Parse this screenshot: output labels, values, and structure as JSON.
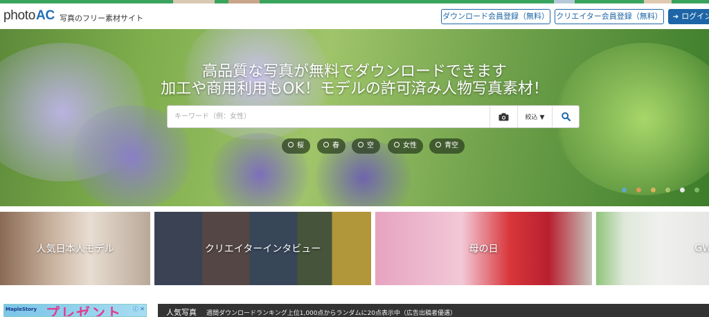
{
  "header": {
    "logo_text": "photo",
    "logo_ac": "AC",
    "tagline": "写真のフリー素材サイト",
    "download_register_label": "ダウンロード会員登録（無料）",
    "creator_register_label": "クリエイター会員登録（無料）",
    "login_label": "ログイン"
  },
  "hero": {
    "headline_1": "高品質な写真が無料でダウンロードできます",
    "headline_2": "加工や商用利用もOK！モデルの許可済み人物写真素材！",
    "search": {
      "placeholder": "キーワード（例：女性）",
      "value": "",
      "filter_label": "絞込 ▼"
    },
    "chips": [
      {
        "label": "桜"
      },
      {
        "label": "春"
      },
      {
        "label": "空"
      },
      {
        "label": "女性"
      },
      {
        "label": "青空"
      }
    ],
    "carousel_dots": [
      "#5fa8c8",
      "#d99a5a",
      "#d9b45a",
      "#a8c86a",
      "#e8e8e8",
      "#7fb86a"
    ]
  },
  "features": [
    {
      "label": "人気日本人モデル"
    },
    {
      "label": "クリエイターインタビュー"
    },
    {
      "label": "母の日"
    },
    {
      "label": "GW"
    }
  ],
  "ad": {
    "brand": "MapleStory",
    "text": "プレゼント",
    "badge": "ⓘ ✕"
  },
  "ranking": {
    "title": "人気写真",
    "subtitle": "週間ダウンロードランキング上位1,000点からランダムに20点表示中（広告出稿者優遇）"
  },
  "colors": {
    "accent": "#1d65a6",
    "top_strip": "#3aa35d",
    "ranking_bar": "#333333"
  }
}
